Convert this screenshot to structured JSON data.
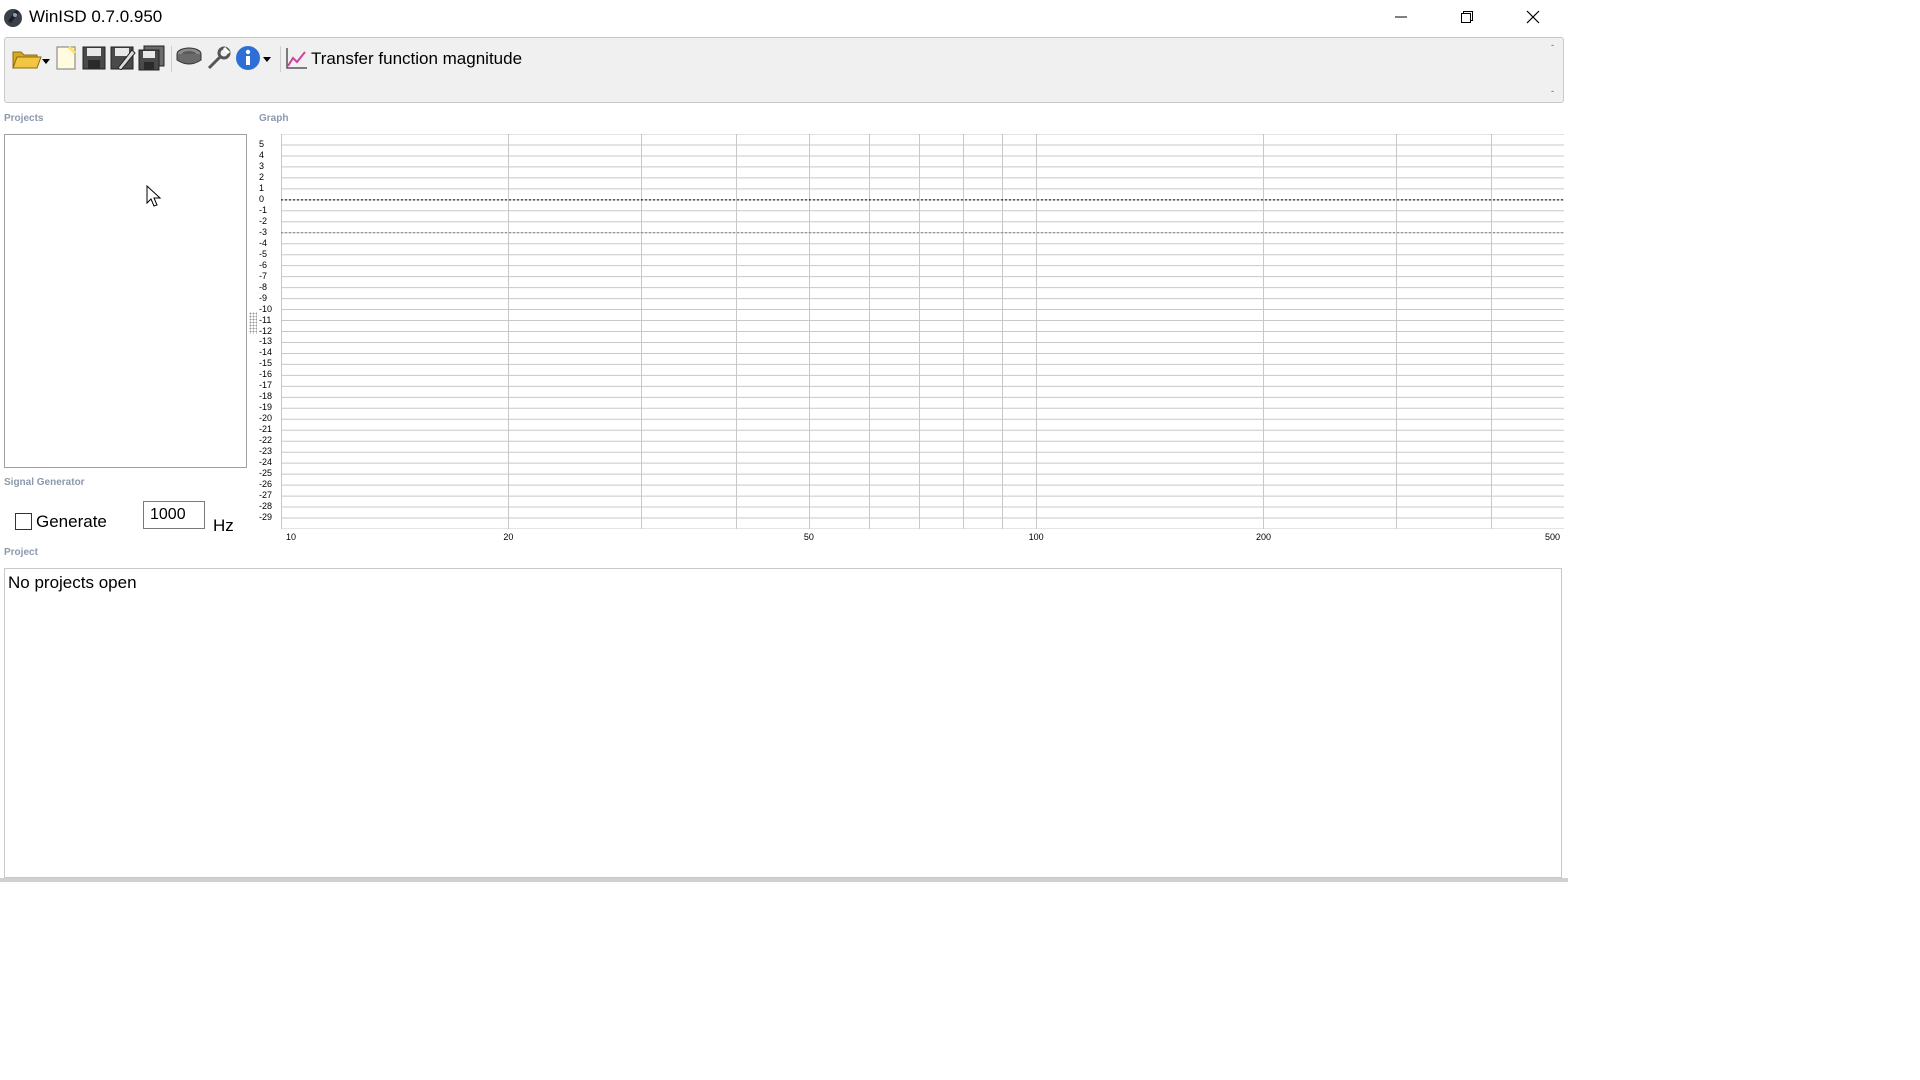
{
  "window": {
    "title": "WinISD 0.7.0.950",
    "controls": [
      "minimize-icon",
      "restore-icon",
      "close-icon"
    ]
  },
  "toolbar": {
    "icons": [
      "open-folder-icon",
      "new-project-icon",
      "save-icon",
      "save-as-icon",
      "save-all-icon",
      "driver-icon",
      "tools-icon",
      "info-icon"
    ],
    "graph_selector_label": "Transfer function magnitude"
  },
  "projects": {
    "group_label": "Projects"
  },
  "graph": {
    "group_label": "Graph",
    "y_ticks": [
      "5",
      "4",
      "3",
      "2",
      "1",
      "0",
      "-1",
      "-2",
      "-3",
      "-4",
      "-5",
      "-6",
      "-7",
      "-8",
      "-9",
      "-10",
      "-11",
      "-12",
      "-13",
      "-14",
      "-15",
      "-16",
      "-17",
      "-18",
      "-19",
      "-20",
      "-21",
      "-22",
      "-23",
      "-24",
      "-25",
      "-26",
      "-27",
      "-28",
      "-29"
    ],
    "x_ticks": [
      "10",
      "20",
      "50",
      "100",
      "200",
      "500"
    ],
    "colors": {
      "grid": "#c8c8c8",
      "zero_line": "#000000",
      "ref_line": "#808080"
    }
  },
  "signal_generator": {
    "group_label": "Signal Generator",
    "generate_label": "Generate",
    "generate_checked": false,
    "frequency_value": "1000",
    "unit_label": "Hz"
  },
  "project_panel": {
    "group_label": "Project",
    "status_text": "No projects open"
  }
}
